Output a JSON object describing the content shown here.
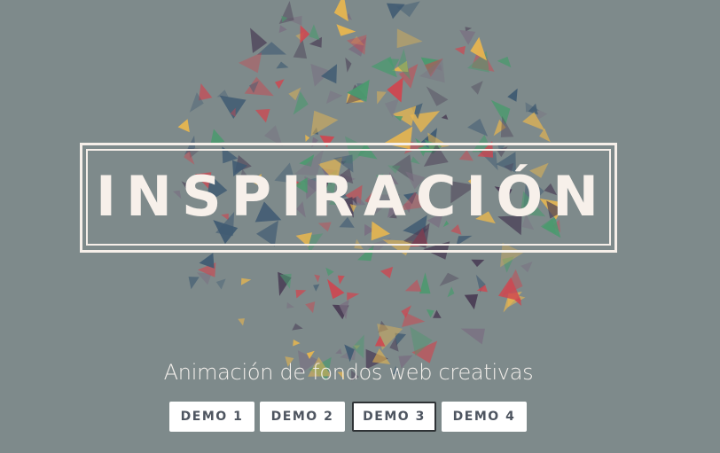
{
  "hero": {
    "title": "INSPIRACIÓN",
    "subtitle": "Animación de fondos web creativas"
  },
  "buttons": [
    {
      "label": "DEMO 1",
      "active": false
    },
    {
      "label": "DEMO 2",
      "active": false
    },
    {
      "label": "DEMO 3",
      "active": true
    },
    {
      "label": "DEMO 4",
      "active": false
    }
  ],
  "colors": {
    "background": "#7e8a8b",
    "text": "#f7f0ea",
    "triangles": [
      "#e8b64f",
      "#d0454f",
      "#4a9a6e",
      "#3f5a72",
      "#4a3d55",
      "#7a7082"
    ]
  }
}
